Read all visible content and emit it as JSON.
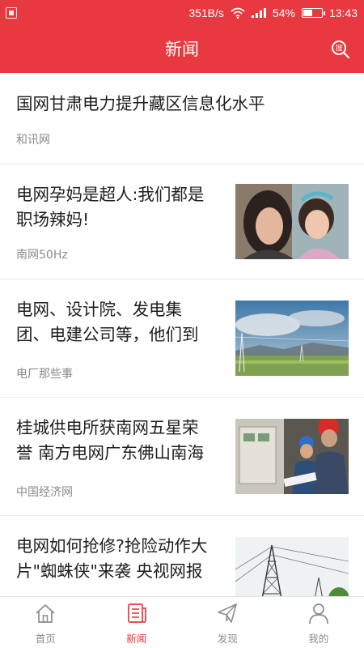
{
  "status_bar": {
    "speed": "351B/s",
    "battery_percent": "54%",
    "battery_level": 0.54,
    "time": "13:43"
  },
  "header": {
    "title": "新闻",
    "search_icon": "search-icon"
  },
  "colors": {
    "brand": "#e7393f",
    "text": "#1e1e1e",
    "muted": "#8a8a8a"
  },
  "feed": {
    "items": [
      {
        "title": "国网甘肃电力提升藏区信息化水平",
        "source": "和讯网"
      },
      {
        "title_line1": "电网孕妈是超人:我们都是",
        "title_line2": "职场辣妈!",
        "source": "南网50Hz",
        "image": "mother-and-child-photo"
      },
      {
        "title_line1": "电网、设计院、发电集",
        "title_line2": "团、电建公司等，他们到",
        "source": "电厂那些事",
        "image": "power-line-landscape-photo"
      },
      {
        "title_line1": "桂城供电所获南网五星荣",
        "title_line2": "誉 南方电网广东佛山南海",
        "source": "中国经济网",
        "image": "electric-workers-photo"
      },
      {
        "title_line1": "电网如何抢修?抢险动作大",
        "title_line2": "片\"蜘蛛侠\"来袭 央视网报",
        "image": "transmission-tower-photo"
      }
    ]
  },
  "tabbar": {
    "tabs": [
      {
        "label": "首页",
        "icon": "home-icon"
      },
      {
        "label": "新闻",
        "icon": "news-icon",
        "active": true
      },
      {
        "label": "发现",
        "icon": "paper-plane-icon"
      },
      {
        "label": "我的",
        "icon": "user-icon"
      }
    ]
  }
}
